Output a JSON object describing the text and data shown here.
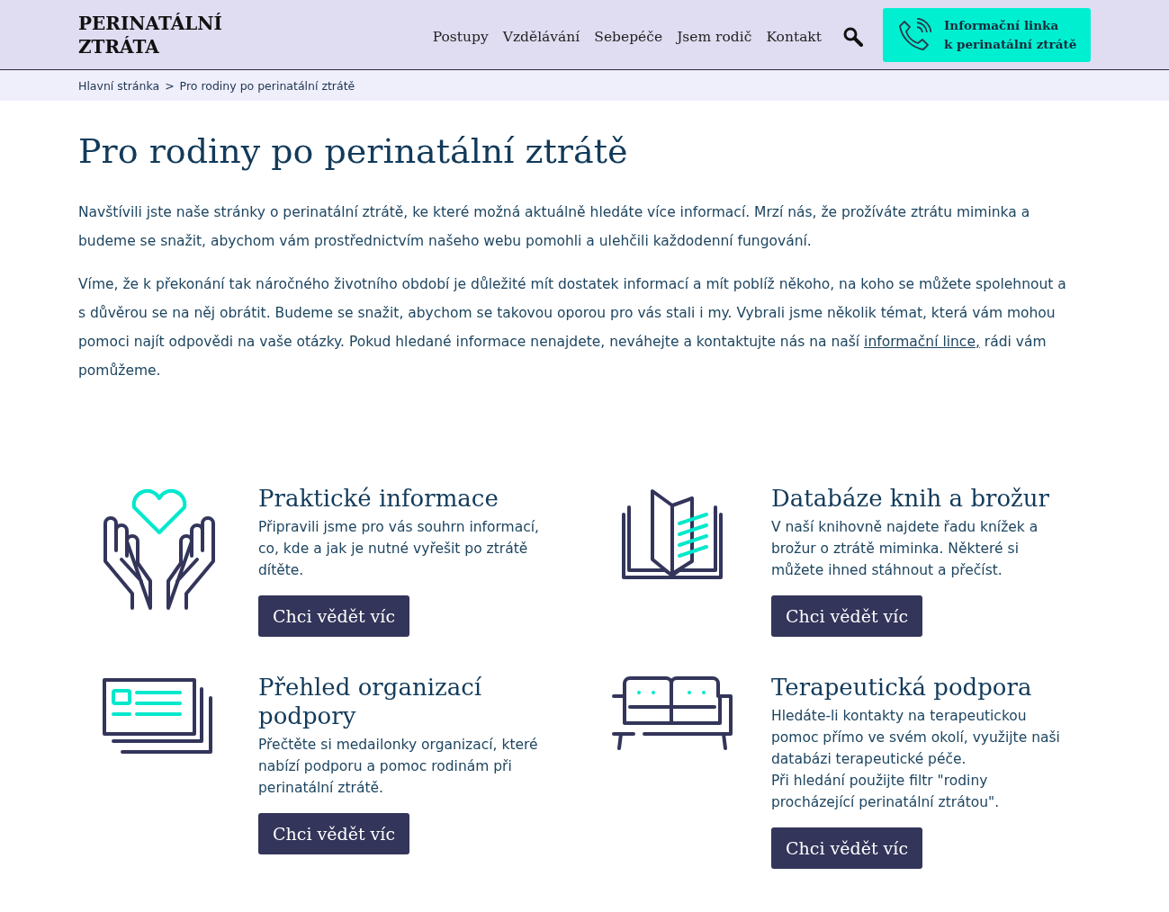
{
  "header": {
    "logo": [
      "PERINATÁLNÍ",
      "ZTRÁTA"
    ],
    "nav": [
      "Postupy",
      "Vzdělávání",
      "Sebepéče",
      "Jsem rodič",
      "Kontakt"
    ],
    "hotline": [
      "Informační linka",
      "k perinatální ztrátě"
    ]
  },
  "breadcrumb": {
    "items": [
      "Hlavní stránka",
      "Pro rodiny po perinatální ztrátě"
    ],
    "separator": ">"
  },
  "title": "Pro rodiny po perinatální ztrátě",
  "intro": [
    {
      "text": "Navštívili jste naše stránky o perinatální ztrátě, ke které možná aktuálně hledáte více informací. Mrzí nás, že prožíváte ztrátu miminka a budeme se snažit, abychom vám prostřednictvím našeho webu pomohli a ulehčili každodenní fungování."
    },
    {
      "text": "Víme, že k překonání tak náročného životního období je důležité mít dostatek informací a mít poblíž někoho, na koho se můžete spolehnout a s důvěrou se na něj obrátit. Budeme se snažit, abychom se takovou oporou pro vás stali i my. Vybrali jsme několik témat, která vám mohou pomoci najít odpovědi na vaše otázky. Pokud hledané informace nenajdete, neváhejte a kontaktujte nás na naší",
      "link": "informační lince,",
      "after": " rádi vám pomůžeme."
    }
  ],
  "cards": [
    {
      "kind": "hands",
      "title": "Praktické informace",
      "text": "Připravili jsme pro vás souhrn informací, co, kde a jak je nutné vyřešit po ztrátě dítěte.",
      "button": "Chci vědět víc"
    },
    {
      "kind": "book",
      "title": "Databáze knih a brožur",
      "text": "V naší knihovně najdete řadu knížek a brožur o ztrátě miminka. Některé si můžete ihned stáhnout a přečíst.",
      "button": "Chci vědět víc"
    },
    {
      "kind": "cards",
      "title": "Přehled organizací podpory",
      "text": "Přečtěte si medailonky organizací, které nabízí podporu a pomoc rodinám při perinatální ztrátě.",
      "button": "Chci vědět víc"
    },
    {
      "kind": "sofa",
      "title": "Terapeutická podpora",
      "text": "Hledáte-li kontakty na terapeutickou pomoc přímo ve svém okolí, využijte naši databázi terapeutické péče.\nPři hledání použijte filtr \"rodiny procházející perinatální ztrátou\".",
      "button": "Chci vědět víc"
    }
  ]
}
